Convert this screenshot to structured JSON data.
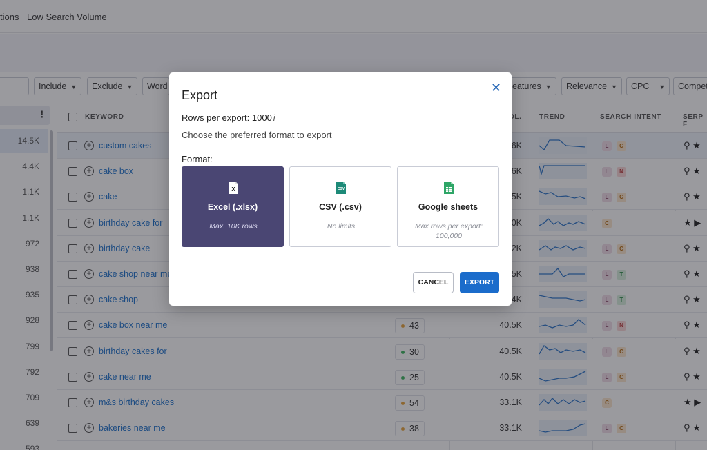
{
  "nav": {
    "items": [
      "tions",
      "Low Search Volume"
    ]
  },
  "filters": [
    "Include",
    "Exclude",
    "Word",
    "eatures",
    "Relevance",
    "CPC",
    "Compet"
  ],
  "headers": {
    "keyword": "KEYWORD",
    "volume": "OL.",
    "trend": "TREND",
    "intent": "SEARCH INTENT",
    "serp": "SERP F"
  },
  "left_values": [
    "14.5K",
    "4.4K",
    "1.1K",
    "1.1K",
    "972",
    "938",
    "935",
    "928",
    "799",
    "792",
    "709",
    "639",
    "593"
  ],
  "rows": [
    {
      "keyword": "custom cakes",
      "kd": "",
      "kd_color": "#e8a33a",
      "volume": "6K",
      "intent": [
        "L",
        "C"
      ],
      "serp": "⚲ ★"
    },
    {
      "keyword": "cake box",
      "kd": "",
      "kd_color": "#e8a33a",
      "volume": "6K",
      "intent": [
        "L",
        "N"
      ],
      "serp": "⚲ ★"
    },
    {
      "keyword": "cake",
      "kd": "",
      "kd_color": "#e8a33a",
      "volume": "5K",
      "intent": [
        "L",
        "C"
      ],
      "serp": "⚲ ★"
    },
    {
      "keyword": "birthday cake for",
      "kd": "",
      "kd_color": "#e8a33a",
      "volume": "0K",
      "intent": [
        "C"
      ],
      "serp": "★ ▶"
    },
    {
      "keyword": "birthday cake",
      "kd": "",
      "kd_color": "#e8a33a",
      "volume": "2K",
      "intent": [
        "L",
        "C"
      ],
      "serp": "⚲ ★"
    },
    {
      "keyword": "cake shop near me",
      "kd": "",
      "kd_color": "#e8a33a",
      "volume": "5K",
      "intent": [
        "L",
        "T"
      ],
      "serp": "⚲ ★"
    },
    {
      "keyword": "cake shop",
      "kd": "",
      "kd_color": "#e8a33a",
      "volume": "4K",
      "intent": [
        "L",
        "T"
      ],
      "serp": "⚲ ★"
    },
    {
      "keyword": "cake box near me",
      "kd": "43",
      "kd_color": "#e8a33a",
      "volume": "40.5K",
      "intent": [
        "L",
        "N"
      ],
      "serp": "⚲ ★"
    },
    {
      "keyword": "birthday cakes for",
      "kd": "30",
      "kd_color": "#3bb55e",
      "volume": "40.5K",
      "intent": [
        "L",
        "C"
      ],
      "serp": "⚲ ★"
    },
    {
      "keyword": "cake near me",
      "kd": "25",
      "kd_color": "#3bb55e",
      "volume": "40.5K",
      "intent": [
        "L",
        "C"
      ],
      "serp": "⚲ ★"
    },
    {
      "keyword": "m&s birthday cakes",
      "kd": "54",
      "kd_color": "#e8a33a",
      "volume": "33.1K",
      "intent": [
        "C"
      ],
      "serp": "★ ▶"
    },
    {
      "keyword": "bakeries near me",
      "kd": "38",
      "kd_color": "#e8a33a",
      "volume": "33.1K",
      "intent": [
        "L",
        "C"
      ],
      "serp": "⚲ ★"
    }
  ],
  "modal": {
    "title": "Export",
    "close_icon": "close-icon",
    "rows_label": "Rows per export: 1000",
    "info_glyph": "i",
    "hint": "Choose the preferred format to export",
    "format_label": "Format:",
    "formats": [
      {
        "name": "Excel (.xlsx)",
        "sub": "Max. 10K rows",
        "icon": "excel-file-icon",
        "color": "#1f1f1f",
        "selected": true
      },
      {
        "name": "CSV (.csv)",
        "sub": "No limits",
        "icon": "csv-file-icon",
        "color": "#1d8a78",
        "selected": false
      },
      {
        "name": "Google sheets",
        "sub": "Max rows per export: 100,000",
        "icon": "google-sheets-icon",
        "color": "#2ea667",
        "selected": false
      }
    ],
    "cancel_label": "CANCEL",
    "export_label": "EXPORT"
  },
  "colors": {
    "accent": "#1b6ccb",
    "selected_card": "#4a4673",
    "link": "#1a6fcb"
  }
}
